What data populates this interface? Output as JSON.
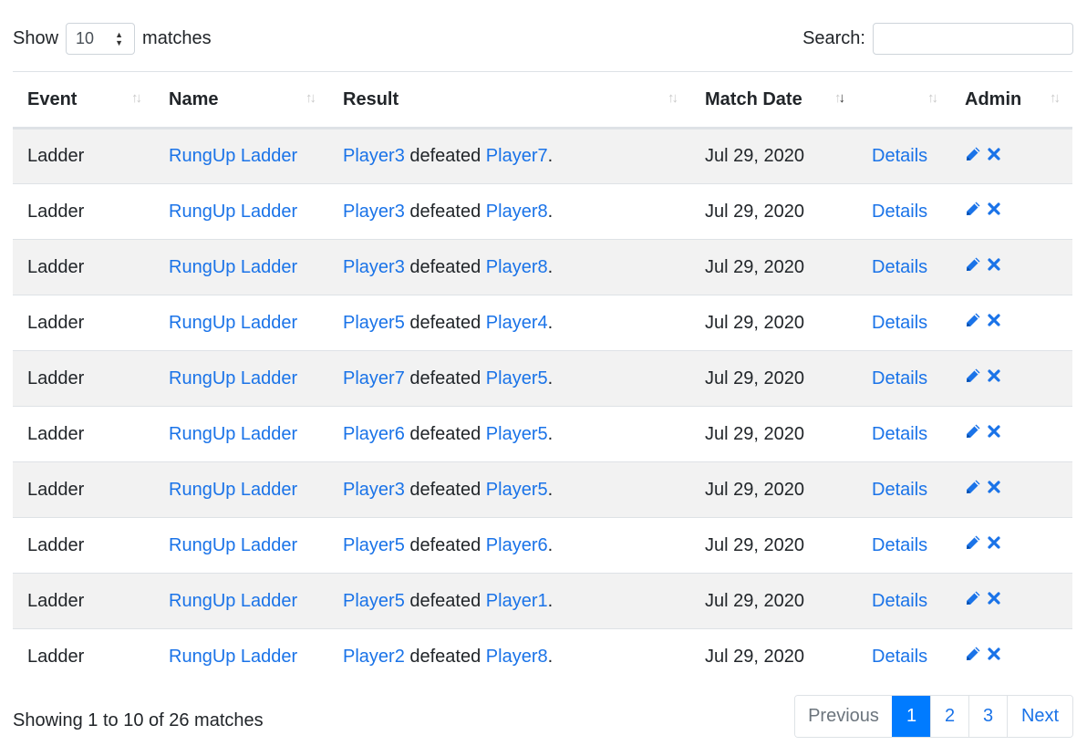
{
  "controls": {
    "show_label": "Show",
    "page_size": "10",
    "matches_label": "matches",
    "search_label": "Search:",
    "search_value": ""
  },
  "table": {
    "columns": [
      {
        "label": "Event",
        "sort": "none"
      },
      {
        "label": "Name",
        "sort": "none"
      },
      {
        "label": "Result",
        "sort": "none"
      },
      {
        "label": "Match Date",
        "sort": "desc"
      },
      {
        "label": "",
        "sort": "none"
      },
      {
        "label": "Admin",
        "sort": "none"
      }
    ],
    "rows": [
      {
        "event": "Ladder",
        "name": "RungUp Ladder",
        "winner": "Player3",
        "verb": "defeated",
        "loser": "Player7",
        "date": "Jul 29, 2020",
        "details": "Details"
      },
      {
        "event": "Ladder",
        "name": "RungUp Ladder",
        "winner": "Player3",
        "verb": "defeated",
        "loser": "Player8",
        "date": "Jul 29, 2020",
        "details": "Details"
      },
      {
        "event": "Ladder",
        "name": "RungUp Ladder",
        "winner": "Player3",
        "verb": "defeated",
        "loser": "Player8",
        "date": "Jul 29, 2020",
        "details": "Details"
      },
      {
        "event": "Ladder",
        "name": "RungUp Ladder",
        "winner": "Player5",
        "verb": "defeated",
        "loser": "Player4",
        "date": "Jul 29, 2020",
        "details": "Details"
      },
      {
        "event": "Ladder",
        "name": "RungUp Ladder",
        "winner": "Player7",
        "verb": "defeated",
        "loser": "Player5",
        "date": "Jul 29, 2020",
        "details": "Details"
      },
      {
        "event": "Ladder",
        "name": "RungUp Ladder",
        "winner": "Player6",
        "verb": "defeated",
        "loser": "Player5",
        "date": "Jul 29, 2020",
        "details": "Details"
      },
      {
        "event": "Ladder",
        "name": "RungUp Ladder",
        "winner": "Player3",
        "verb": "defeated",
        "loser": "Player5",
        "date": "Jul 29, 2020",
        "details": "Details"
      },
      {
        "event": "Ladder",
        "name": "RungUp Ladder",
        "winner": "Player5",
        "verb": "defeated",
        "loser": "Player6",
        "date": "Jul 29, 2020",
        "details": "Details"
      },
      {
        "event": "Ladder",
        "name": "RungUp Ladder",
        "winner": "Player5",
        "verb": "defeated",
        "loser": "Player1",
        "date": "Jul 29, 2020",
        "details": "Details"
      },
      {
        "event": "Ladder",
        "name": "RungUp Ladder",
        "winner": "Player2",
        "verb": "defeated",
        "loser": "Player8",
        "date": "Jul 29, 2020",
        "details": "Details"
      }
    ],
    "admin_icons": [
      "pencil-icon",
      "close-icon"
    ]
  },
  "footer": {
    "info": "Showing 1 to 10 of 26 matches",
    "pagination": {
      "previous": "Previous",
      "pages": [
        "1",
        "2",
        "3"
      ],
      "current": "1",
      "next": "Next"
    }
  },
  "colors": {
    "link": "#1a73e8",
    "active_page": "#007bff",
    "stripe": "#f2f2f2"
  }
}
